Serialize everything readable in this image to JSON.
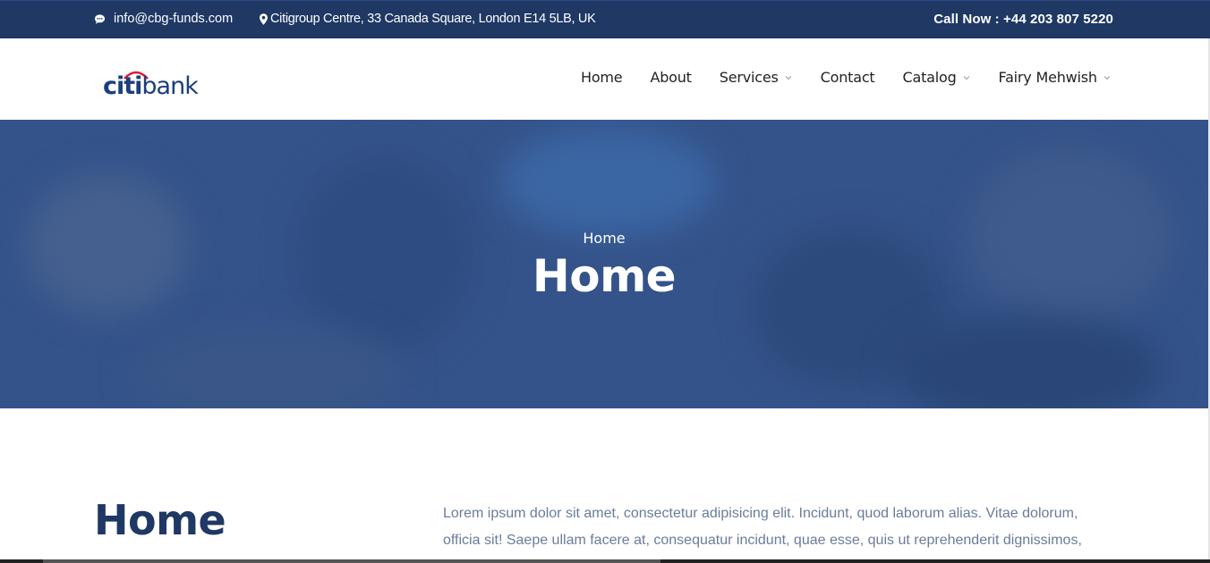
{
  "topbar": {
    "email": "info@cbg-funds.com",
    "address": "Citigroup Centre, 33 Canada Square, London E14 5LB, UK",
    "call_now": "Call Now : +44 203 807 5220",
    "icons": {
      "email": "chat-bubble-icon",
      "address": "map-pin-icon"
    }
  },
  "logo": {
    "citi": "citi",
    "bank": "bank"
  },
  "nav": {
    "items": [
      {
        "label": "Home",
        "dropdown": false
      },
      {
        "label": "About",
        "dropdown": false
      },
      {
        "label": "Services",
        "dropdown": true
      },
      {
        "label": "Contact",
        "dropdown": false
      },
      {
        "label": "Catalog",
        "dropdown": true
      },
      {
        "label": "Fairy Mehwish",
        "dropdown": true
      }
    ]
  },
  "hero": {
    "breadcrumb": "Home",
    "title": "Home"
  },
  "content": {
    "title": "Home",
    "text": "Lorem ipsum dolor sit amet, consectetur adipisicing elit. Incidunt, quod laborum alias. Vitae dolorum, officia sit! Saepe ullam facere at, consequatur incidunt, quae esse, quis ut reprehenderit dignissimos, illo minima"
  },
  "colors": {
    "topbar_bg": "#1f3864",
    "hero_overlay": "#34538a",
    "brand_navy": "#1b3f7d",
    "citi_arc": "#e31937",
    "body_text": "#6a7c9b"
  }
}
